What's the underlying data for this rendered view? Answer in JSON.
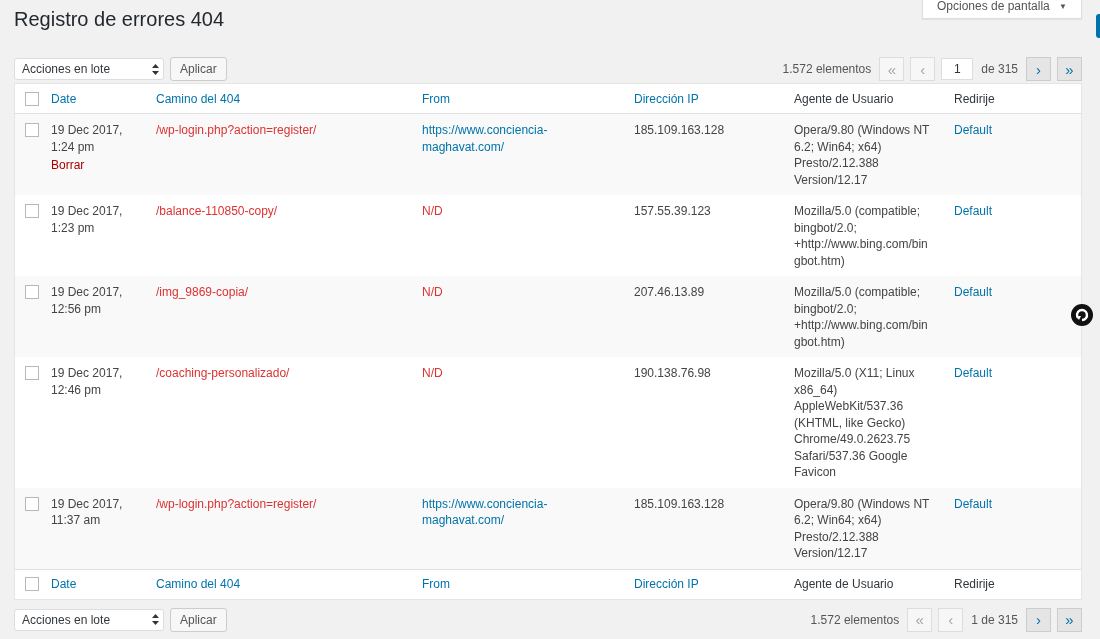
{
  "title": "Registro de errores 404",
  "screen_options": {
    "label": "Opciones de pantalla",
    "caret": "▼"
  },
  "top_nav": {
    "bulk": {
      "value": "Acciones en lote"
    },
    "apply": "Aplicar",
    "count": "1.572 elementos",
    "pager": {
      "first": {
        "label": "«",
        "disabled": true
      },
      "prev": {
        "label": "‹",
        "disabled": true
      },
      "page_input": "1",
      "total": "de 315",
      "next": {
        "label": "›",
        "disabled": false
      },
      "last": {
        "label": "»",
        "disabled": false
      }
    }
  },
  "table": {
    "columns": [
      {
        "label": "Date",
        "sortable": true
      },
      {
        "label": "Camino del 404",
        "sortable": true
      },
      {
        "label": "From",
        "sortable": true
      },
      {
        "label": "Dirección IP",
        "sortable": true
      },
      {
        "label": "Agente de Usuario",
        "sortable": false
      },
      {
        "label": "Redirije",
        "sortable": false
      }
    ],
    "rows": [
      {
        "checked": false,
        "date": "19 Dec 2017, 1:24 pm",
        "actions": [
          "Borrar"
        ],
        "path": "/wp-login.php?action=register/",
        "from": {
          "kind": "link",
          "text": "https://www.conciencia-maghavat.com/"
        },
        "ip": "185.109.163.128",
        "agent": "Opera/9.80 (Windows NT 6.2; Win64; x64) Presto/2.12.388 Version/12.17",
        "redirect": "Default"
      },
      {
        "checked": false,
        "date": "19 Dec 2017, 1:23 pm",
        "path": "/balance-110850-copy/",
        "from": {
          "kind": "none",
          "text": "N/D"
        },
        "ip": "157.55.39.123",
        "agent": "Mozilla/5.0 (compatible; bingbot/2.0; +http://www.bing.com/bingbot.htm)",
        "redirect": "Default"
      },
      {
        "checked": false,
        "date": "19 Dec 2017, 12:56 pm",
        "path": "/img_9869-copia/",
        "from": {
          "kind": "none",
          "text": "N/D"
        },
        "ip": "207.46.13.89",
        "agent": "Mozilla/5.0 (compatible; bingbot/2.0; +http://www.bing.com/bingbot.htm)",
        "redirect": "Default"
      },
      {
        "checked": false,
        "date": "19 Dec 2017, 12:46 pm",
        "path": "/coaching-personalizado/",
        "from": {
          "kind": "none",
          "text": "N/D"
        },
        "ip": "190.138.76.98",
        "agent": "Mozilla/5.0 (X11; Linux x86_64) AppleWebKit/537.36 (KHTML, like Gecko) Chrome/49.0.2623.75 Safari/537.36 Google Favicon",
        "redirect": "Default"
      },
      {
        "checked": false,
        "date": "19 Dec 2017, 11:37 am",
        "path": "/wp-login.php?action=register/",
        "from": {
          "kind": "link",
          "text": "https://www.conciencia-maghavat.com/"
        },
        "ip": "185.109.163.128",
        "agent": "Opera/9.80 (Windows NT 6.2; Win64; x64) Presto/2.12.388 Version/12.17",
        "redirect": "Default"
      }
    ],
    "footer_columns": [
      {
        "label": "Date",
        "sortable": true
      },
      {
        "label": "Camino del 404",
        "sortable": true
      },
      {
        "label": "From",
        "sortable": true
      },
      {
        "label": "Dirección IP",
        "sortable": true
      },
      {
        "label": "Agente de Usuario",
        "sortable": false
      },
      {
        "label": "Redirije",
        "sortable": false
      }
    ],
    "select_all_checked": false,
    "footer_select_all_checked": false
  },
  "bottom_nav": {
    "bulk": {
      "value": "Acciones en lote"
    },
    "apply": "Aplicar",
    "count": "1.572 elementos",
    "pager": {
      "first": {
        "label": "«",
        "disabled": true
      },
      "prev": {
        "label": "‹",
        "disabled": true
      },
      "page_text": "1 de 315",
      "next": {
        "label": "›",
        "disabled": false
      },
      "last": {
        "label": "»",
        "disabled": false
      }
    }
  }
}
